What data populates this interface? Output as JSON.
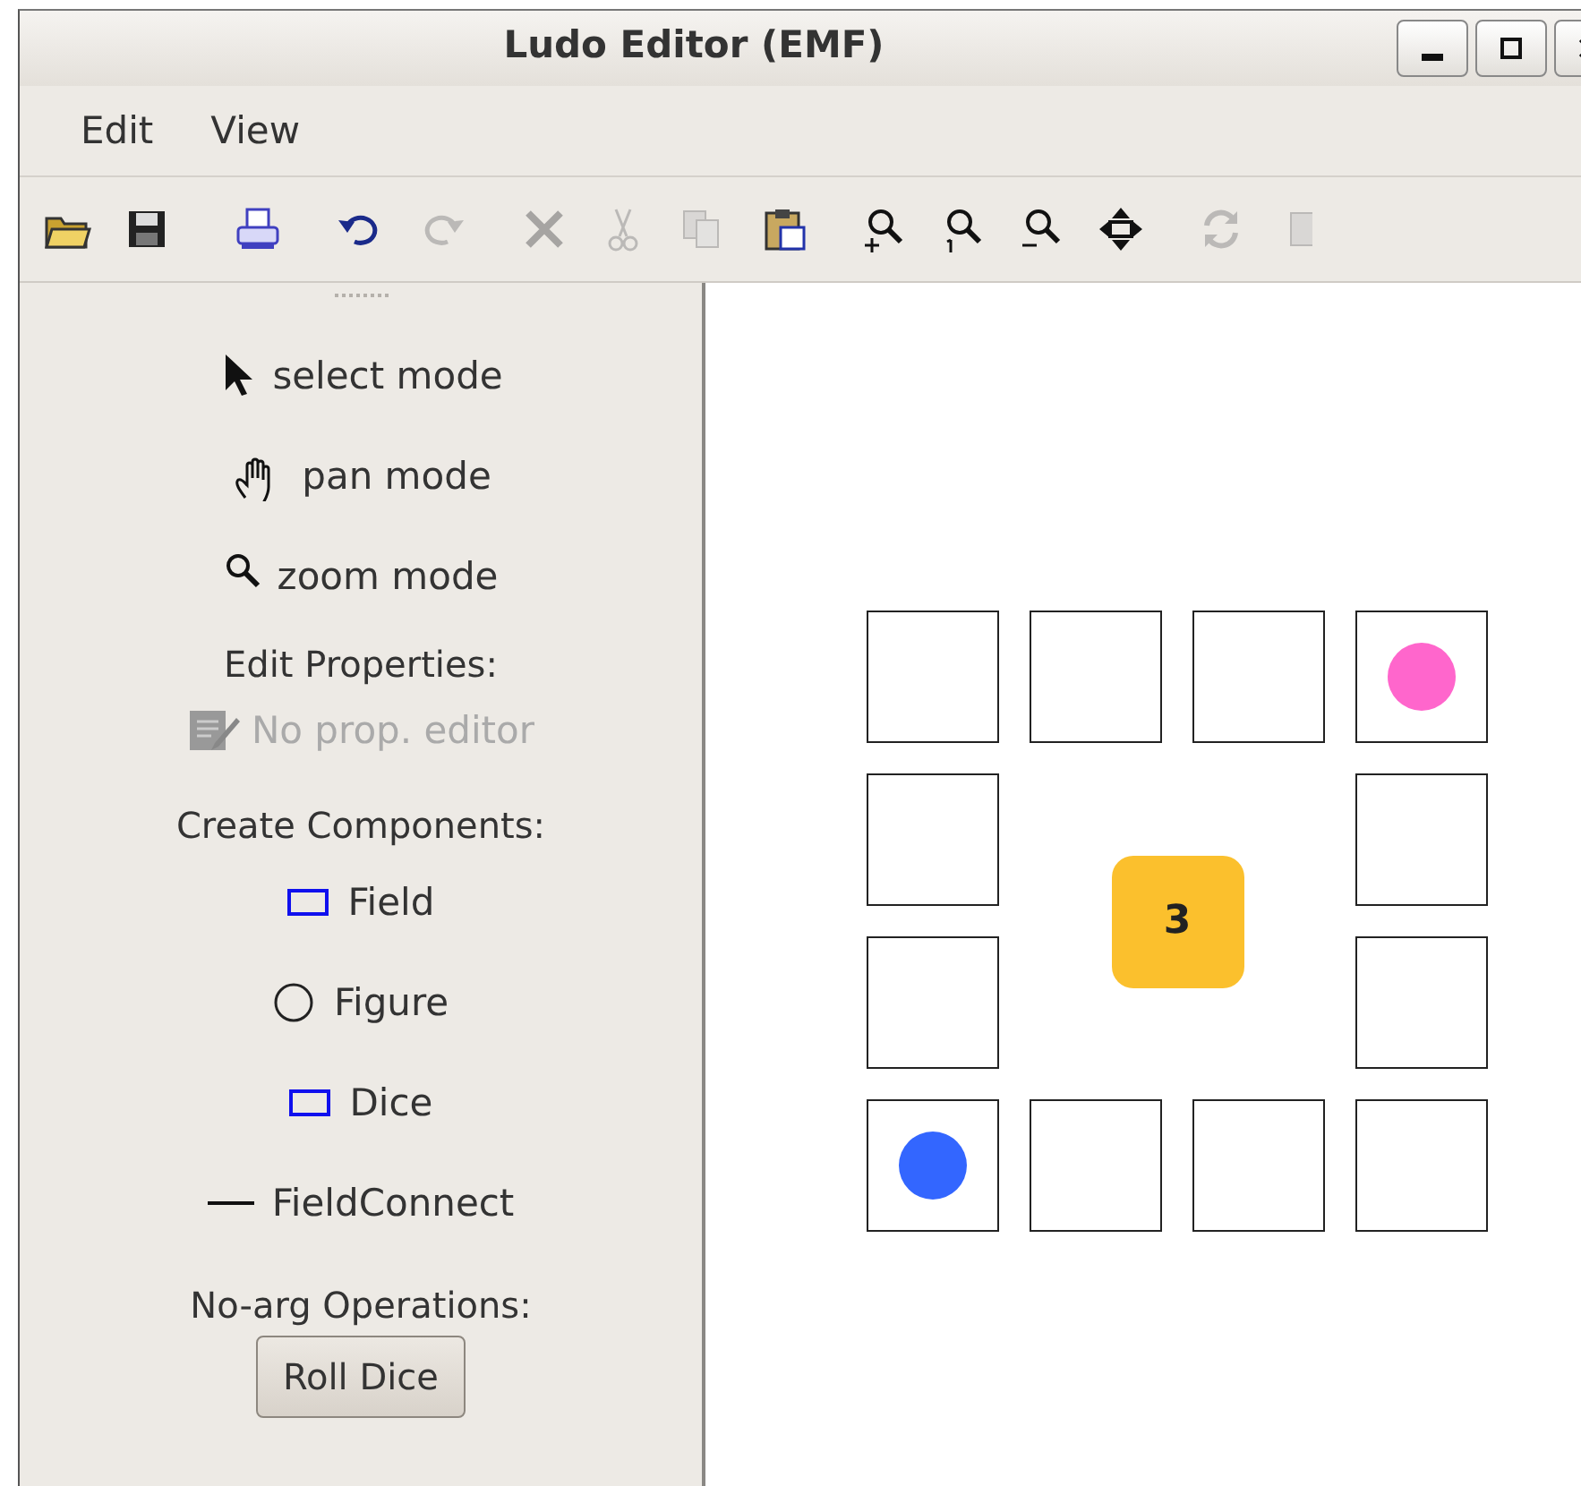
{
  "window": {
    "title": "Ludo Editor (EMF)",
    "controls": [
      {
        "kind": "minimize"
      },
      {
        "kind": "maximize"
      },
      {
        "kind": "close"
      }
    ]
  },
  "menu": [
    "Edit",
    "View"
  ],
  "toolbar": [
    {
      "kind": "open",
      "disabled": false
    },
    {
      "kind": "save",
      "disabled": false
    },
    {
      "kind": "print",
      "disabled": false
    },
    {
      "kind": "undo",
      "disabled": false
    },
    {
      "kind": "redo",
      "disabled": true
    },
    {
      "kind": "delete",
      "disabled": true
    },
    {
      "kind": "cut",
      "disabled": true
    },
    {
      "kind": "copy",
      "disabled": true
    },
    {
      "kind": "paste",
      "disabled": false
    },
    {
      "kind": "zoom-in",
      "disabled": false
    },
    {
      "kind": "zoom-reset",
      "disabled": false
    },
    {
      "kind": "zoom-out",
      "disabled": false
    },
    {
      "kind": "fit",
      "disabled": false
    },
    {
      "kind": "refresh",
      "disabled": true
    },
    {
      "kind": "image",
      "disabled": true
    }
  ],
  "sidebar": {
    "modes": [
      {
        "kind": "select",
        "label": "select mode"
      },
      {
        "kind": "pan",
        "label": "pan mode"
      },
      {
        "kind": "zoom",
        "label": "zoom mode"
      }
    ],
    "properties": {
      "heading": "Edit Properties:",
      "editor": {
        "label": "No prop. editor",
        "disabled": true
      }
    },
    "components": {
      "heading": "Create Components:",
      "items": [
        {
          "kind": "rect",
          "label": "Field"
        },
        {
          "kind": "circle",
          "label": "Figure"
        },
        {
          "kind": "rect",
          "label": "Dice"
        },
        {
          "kind": "line",
          "label": "FieldConnect"
        }
      ]
    },
    "operations": {
      "heading": "No-arg Operations:",
      "buttons": [
        "Roll Dice"
      ]
    }
  },
  "board": {
    "dice": "3",
    "fields": [
      {
        "kind": "empty"
      },
      {
        "kind": "empty"
      },
      {
        "kind": "empty"
      },
      {
        "kind": "figure",
        "color": "#ff66cc"
      },
      {
        "kind": "empty"
      },
      {
        "kind": "empty"
      },
      {
        "kind": "empty"
      },
      {
        "kind": "empty"
      },
      {
        "kind": "empty"
      },
      {
        "kind": "figure",
        "color": "#3366ff"
      },
      {
        "kind": "empty"
      },
      {
        "kind": "empty"
      }
    ]
  }
}
